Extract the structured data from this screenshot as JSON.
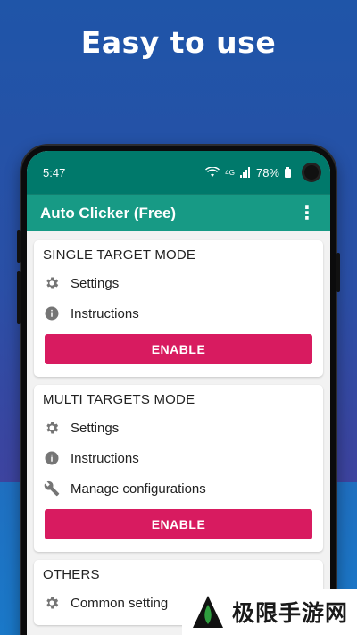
{
  "headline": "Easy to use",
  "status_bar": {
    "time": "5:47",
    "network": "4G",
    "battery": "78%"
  },
  "app_bar": {
    "title": "Auto Clicker (Free)",
    "menu_icon": "more-vert-icon"
  },
  "cards": {
    "single": {
      "title": "SINGLE TARGET MODE",
      "settings": "Settings",
      "instructions": "Instructions",
      "enable": "ENABLE"
    },
    "multi": {
      "title": "MULTI TARGETS MODE",
      "settings": "Settings",
      "instructions": "Instructions",
      "manage": "Manage configurations",
      "enable": "ENABLE"
    },
    "others": {
      "title": "OTHERS",
      "common": "Common setting"
    }
  },
  "watermark": {
    "text": "极限手游网"
  },
  "colors": {
    "status_bar": "#00796b",
    "app_bar": "#179a85",
    "enable_button": "#d81b60",
    "background": "#2a4fa6"
  }
}
